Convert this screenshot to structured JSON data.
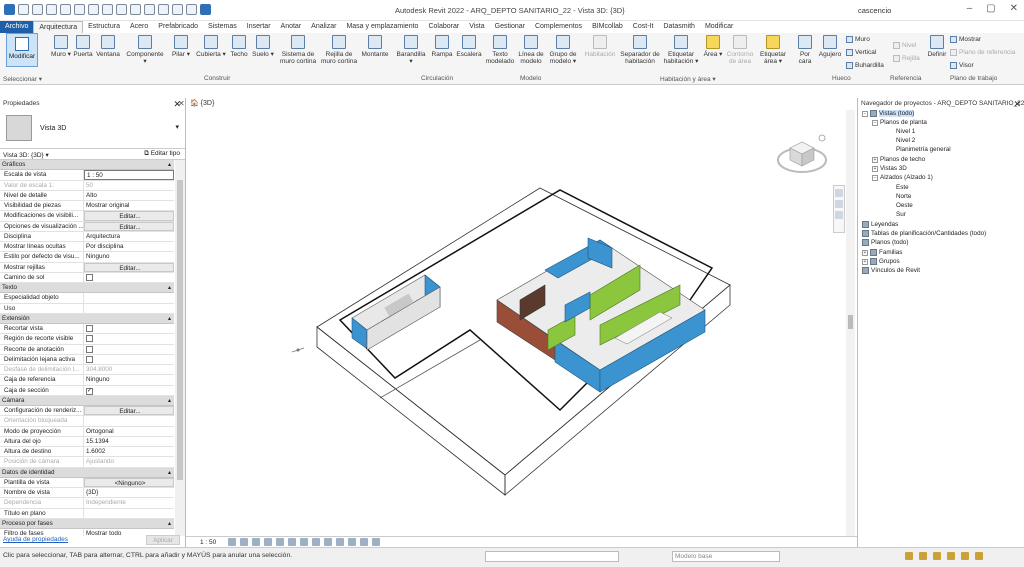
{
  "app": {
    "title": "Autodesk Revit 2022 - ARQ_DEPTO SANITARIO_22 - Vista 3D: {3D}",
    "user": "cascencio"
  },
  "menu": [
    "Archivo",
    "Arquitectura",
    "Estructura",
    "Acero",
    "Prefabricado",
    "Sistemas",
    "Insertar",
    "Anotar",
    "Analizar",
    "Masa y emplazamiento",
    "Colaborar",
    "Vista",
    "Gestionar",
    "Complementos",
    "BIMcollab",
    "Cost-It",
    "Datasmith",
    "Modificar"
  ],
  "ribbon": {
    "modify": "Modificar",
    "select": "Seleccionar ▾",
    "buttons": [
      "Muro",
      "Puerta",
      "Ventana",
      "Componente",
      "Pilar",
      "Cubierta",
      "Techo",
      "Suelo",
      "Sistema de muro cortina",
      "Rejilla de muro cortina",
      "Montante",
      "Barandilla",
      "Rampa",
      "Escalera",
      "Texto modelado",
      "Línea de modelo",
      "Grupo de modelo",
      "Habitación",
      "Separador de habitación",
      "Etiquetar habitación",
      "Área",
      "Contorno de área",
      "Etiquetar área",
      "Por cara",
      "Agujero",
      "Definir"
    ],
    "small": [
      "Muro",
      "Vertical",
      "Buhardilla",
      "Nivel",
      "Rejilla",
      "Mostrar",
      "Plano de referencia",
      "Visor"
    ],
    "panels": [
      "Construir",
      "Circulación",
      "Modelo",
      "Habitación y área ▾",
      "Hueco",
      "Referencia",
      "Plano de trabajo"
    ]
  },
  "properties": {
    "title": "Propiedades",
    "type_name": "Vista 3D",
    "instance": "Vista 3D: {3D}",
    "edit_type": "Editar tipo",
    "help": "Ayuda de propiedades",
    "apply": "Aplicar",
    "rows": [
      {
        "g": "Gráficos"
      },
      {
        "k": "Escala de vista",
        "v": "1 : 50",
        "box": true
      },
      {
        "k": "Valor de escala    1:",
        "v": "50",
        "dim": true
      },
      {
        "k": "Nivel de detalle",
        "v": "Alto"
      },
      {
        "k": "Visibilidad de piezas",
        "v": "Mostrar original"
      },
      {
        "k": "Modificaciones de visibili...",
        "v": "Editar...",
        "btn": true
      },
      {
        "k": "Opciones de visualización ...",
        "v": "Editar...",
        "btn": true
      },
      {
        "k": "Disciplina",
        "v": "Arquitectura"
      },
      {
        "k": "Mostrar líneas ocultas",
        "v": "Por disciplina"
      },
      {
        "k": "Estilo por defecto de visu...",
        "v": "Ninguno"
      },
      {
        "k": "Mostrar rejillas",
        "v": "Editar...",
        "btn": true
      },
      {
        "k": "Camino de sol",
        "cb": true
      },
      {
        "g": "Texto"
      },
      {
        "k": "Especialidad objeto",
        "v": ""
      },
      {
        "k": "Uso",
        "v": ""
      },
      {
        "g": "Extensión"
      },
      {
        "k": "Recortar vista",
        "cb": true
      },
      {
        "k": "Región de recorte visible",
        "cb": true
      },
      {
        "k": "Recorte de anotación",
        "cb": true
      },
      {
        "k": "Delimitación lejana activa",
        "cb": true
      },
      {
        "k": "Desfase de delimitación l...",
        "v": "304.8000",
        "dim": true
      },
      {
        "k": "Caja de referencia",
        "v": "Ninguno"
      },
      {
        "k": "Caja de sección",
        "cb": true,
        "checked": "✓"
      },
      {
        "g": "Cámara"
      },
      {
        "k": "Configuración de renderiz...",
        "v": "Editar...",
        "btn": true
      },
      {
        "k": "Orientación bloqueada",
        "v": "",
        "dim": true
      },
      {
        "k": "Modo de proyección",
        "v": "Ortogonal"
      },
      {
        "k": "Altura del ojo",
        "v": "15.1394"
      },
      {
        "k": "Altura de destino",
        "v": "1.6002"
      },
      {
        "k": "Posición de cámara",
        "v": "Ajustando",
        "dim": true
      },
      {
        "g": "Datos de identidad"
      },
      {
        "k": "Plantilla de vista",
        "v": "<Ninguno>",
        "btn": true
      },
      {
        "k": "Nombre de vista",
        "v": "{3D}"
      },
      {
        "k": "Dependencia",
        "v": "Independiente",
        "dim": true
      },
      {
        "k": "Título en plano",
        "v": ""
      },
      {
        "g": "Proceso por fases"
      },
      {
        "k": "Filtro de fases",
        "v": "Mostrar todo"
      }
    ]
  },
  "view": {
    "tab": "{3D}",
    "scale": "1 : 50"
  },
  "browser": {
    "title": "Navegador de proyectos - ARQ_DEPTO SANITARIO_22",
    "nodes": [
      "Vistas (todo)",
      "Planos de planta",
      "Nivel 1",
      "Nivel 2",
      "Planimetría general",
      "Planos de techo",
      "Vistas 3D",
      "Alzados (Alzado 1)",
      "Este",
      "Norte",
      "Oeste",
      "Sur",
      "Leyendas",
      "Tablas de planificación/Cantidades (todo)",
      "Planos (todo)",
      "Familias",
      "Grupos",
      "Vínculos de Revit"
    ]
  },
  "status": {
    "text": "Clic para seleccionar, TAB para alternar, CTRL para añadir y MAYÚS para anular una selección.",
    "model": "Modelo base"
  },
  "colors": {
    "wall_blue": "#3b93cf",
    "wall_green": "#8cc63f",
    "file_tab": "#1f5fa8"
  }
}
